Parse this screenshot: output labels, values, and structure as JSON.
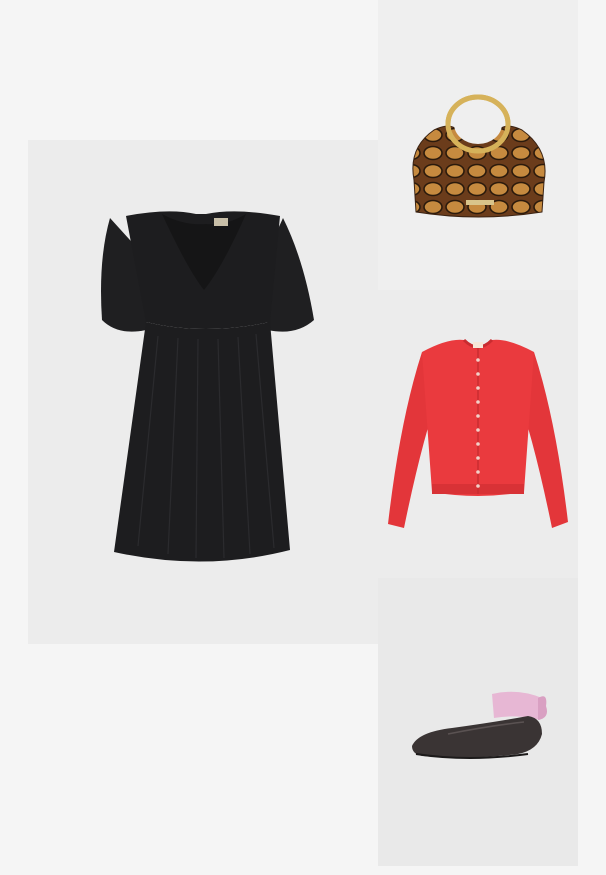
{
  "outfit": {
    "items": [
      {
        "name": "black-mini-dress",
        "color": "#1d1d1f"
      },
      {
        "name": "snakeskin-handbag",
        "color": "#7a4a22",
        "brand_text": "STEVEMADDEN"
      },
      {
        "name": "red-cardigan",
        "color": "#e8383b"
      },
      {
        "name": "ballet-flats",
        "color": "#3a3434",
        "ribbon_color": "#e7b7d4"
      }
    ]
  }
}
